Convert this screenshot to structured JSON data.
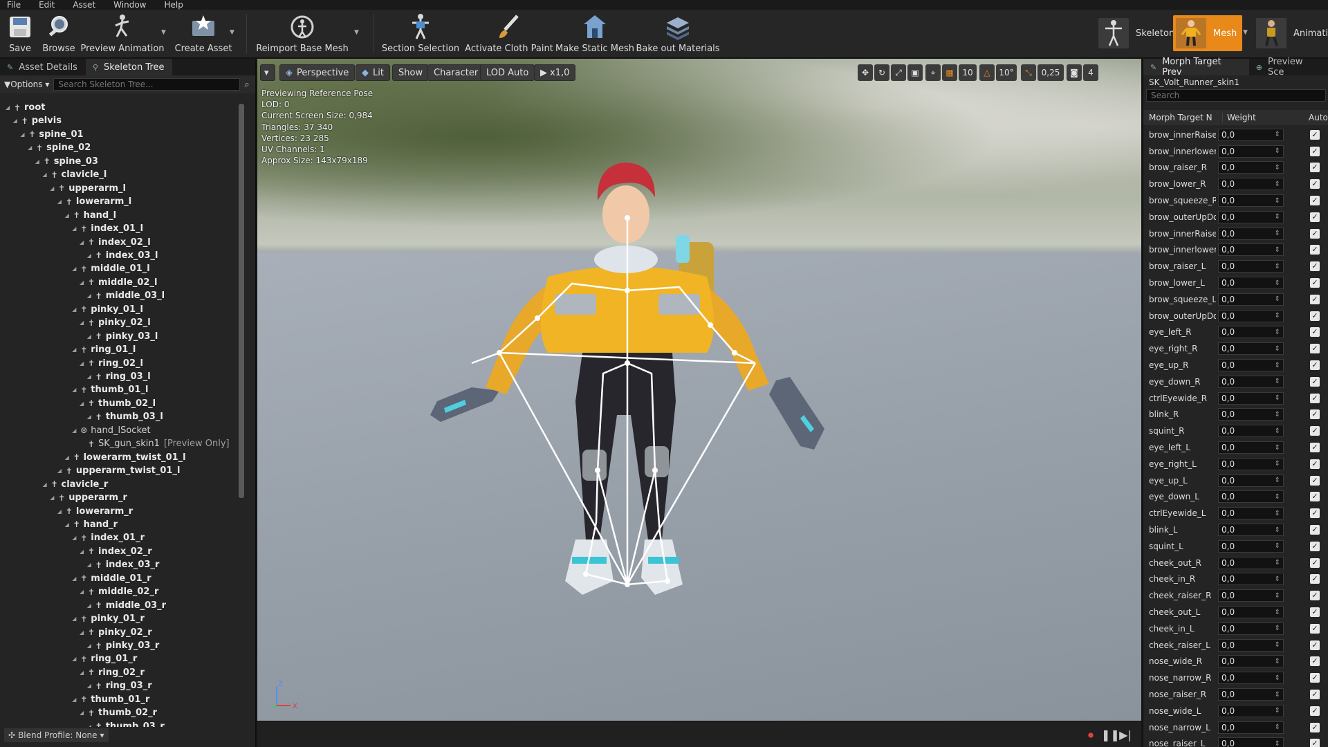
{
  "menu": [
    "File",
    "Edit",
    "Asset",
    "Window",
    "Help"
  ],
  "toolbar": {
    "buttons": [
      {
        "label": "Save"
      },
      {
        "label": "Browse"
      },
      {
        "label": "Preview Animation"
      },
      {
        "label": "Create Asset"
      },
      {
        "label": "Reimport Base Mesh"
      },
      {
        "label": "Section Selection"
      },
      {
        "label": "Activate Cloth Paint"
      },
      {
        "label": "Make Static Mesh"
      },
      {
        "label": "Bake out Materials"
      }
    ],
    "modes": [
      {
        "label": "Skeleton"
      },
      {
        "label": "Mesh"
      },
      {
        "label": "Animatio"
      }
    ],
    "colors": {
      "active_mode": "#e8891a"
    }
  },
  "left_panel": {
    "tabs": [
      {
        "label": "Asset Details"
      },
      {
        "label": "Skeleton Tree"
      }
    ],
    "options_label": "Options",
    "search_placeholder": "Search Skeleton Tree...",
    "tree": [
      {
        "label": "root",
        "depth": 0
      },
      {
        "label": "pelvis",
        "depth": 1
      },
      {
        "label": "spine_01",
        "depth": 2
      },
      {
        "label": "spine_02",
        "depth": 3
      },
      {
        "label": "spine_03",
        "depth": 4
      },
      {
        "label": "clavicle_l",
        "depth": 5
      },
      {
        "label": "upperarm_l",
        "depth": 6
      },
      {
        "label": "lowerarm_l",
        "depth": 7
      },
      {
        "label": "hand_l",
        "depth": 8
      },
      {
        "label": "index_01_l",
        "depth": 9
      },
      {
        "label": "index_02_l",
        "depth": 10
      },
      {
        "label": "index_03_l",
        "depth": 11
      },
      {
        "label": "middle_01_l",
        "depth": 9
      },
      {
        "label": "middle_02_l",
        "depth": 10
      },
      {
        "label": "middle_03_l",
        "depth": 11
      },
      {
        "label": "pinky_01_l",
        "depth": 9
      },
      {
        "label": "pinky_02_l",
        "depth": 10
      },
      {
        "label": "pinky_03_l",
        "depth": 11
      },
      {
        "label": "ring_01_l",
        "depth": 9
      },
      {
        "label": "ring_02_l",
        "depth": 10
      },
      {
        "label": "ring_03_l",
        "depth": 11
      },
      {
        "label": "thumb_01_l",
        "depth": 9
      },
      {
        "label": "thumb_02_l",
        "depth": 10
      },
      {
        "label": "thumb_03_l",
        "depth": 11
      },
      {
        "label": "hand_lSocket",
        "depth": 9,
        "kind": "socket"
      },
      {
        "label": "SK_gun_skin1",
        "depth": 10,
        "kind": "mesh",
        "suffix": "[Preview Only]"
      },
      {
        "label": "lowerarm_twist_01_l",
        "depth": 8
      },
      {
        "label": "upperarm_twist_01_l",
        "depth": 7
      },
      {
        "label": "clavicle_r",
        "depth": 5
      },
      {
        "label": "upperarm_r",
        "depth": 6
      },
      {
        "label": "lowerarm_r",
        "depth": 7
      },
      {
        "label": "hand_r",
        "depth": 8
      },
      {
        "label": "index_01_r",
        "depth": 9
      },
      {
        "label": "index_02_r",
        "depth": 10
      },
      {
        "label": "index_03_r",
        "depth": 11
      },
      {
        "label": "middle_01_r",
        "depth": 9
      },
      {
        "label": "middle_02_r",
        "depth": 10
      },
      {
        "label": "middle_03_r",
        "depth": 11
      },
      {
        "label": "pinky_01_r",
        "depth": 9
      },
      {
        "label": "pinky_02_r",
        "depth": 10
      },
      {
        "label": "pinky_03_r",
        "depth": 11
      },
      {
        "label": "ring_01_r",
        "depth": 9
      },
      {
        "label": "ring_02_r",
        "depth": 10
      },
      {
        "label": "ring_03_r",
        "depth": 11
      },
      {
        "label": "thumb_01_r",
        "depth": 9
      },
      {
        "label": "thumb_02_r",
        "depth": 10
      },
      {
        "label": "thumb_03_r",
        "depth": 11
      }
    ],
    "blend_profile": "Blend Profile: None"
  },
  "viewport": {
    "buttons": [
      "Perspective",
      "Lit",
      "Show",
      "Character",
      "LOD Auto",
      "x1,0"
    ],
    "right_values": {
      "grid_snap": "10",
      "rotation_snap": "10°",
      "scale_snap": "0,25",
      "camera_speed": "4"
    },
    "stats": [
      "Previewing Reference Pose",
      "LOD: 0",
      "Current Screen Size: 0,984",
      "Triangles: 37 340",
      "Vertices: 23 285",
      "UV Channels: 1",
      "Approx Size: 143x79x189"
    ],
    "axis": {
      "z": "Z",
      "x": "X"
    }
  },
  "right_panel": {
    "tabs": [
      {
        "label": "Morph Target Prev"
      },
      {
        "label": "Preview Sce"
      }
    ],
    "asset_name": "SK_Volt_Runner_skin1",
    "search_placeholder": "Search",
    "columns": [
      "Morph Target N",
      "Weight",
      "Auto"
    ],
    "morphs": [
      {
        "name": "brow_innerRaise",
        "weight": "0,0"
      },
      {
        "name": "brow_innerlower",
        "weight": "0,0"
      },
      {
        "name": "brow_raiser_R",
        "weight": "0,0"
      },
      {
        "name": "brow_lower_R",
        "weight": "0,0"
      },
      {
        "name": "brow_squeeze_R",
        "weight": "0,0"
      },
      {
        "name": "brow_outerUpDo",
        "weight": "0,0"
      },
      {
        "name": "brow_innerRaise",
        "weight": "0,0"
      },
      {
        "name": "brow_innerlower",
        "weight": "0,0"
      },
      {
        "name": "brow_raiser_L",
        "weight": "0,0"
      },
      {
        "name": "brow_lower_L",
        "weight": "0,0"
      },
      {
        "name": "brow_squeeze_L",
        "weight": "0,0"
      },
      {
        "name": "brow_outerUpDo",
        "weight": "0,0"
      },
      {
        "name": "eye_left_R",
        "weight": "0,0"
      },
      {
        "name": "eye_right_R",
        "weight": "0,0"
      },
      {
        "name": "eye_up_R",
        "weight": "0,0"
      },
      {
        "name": "eye_down_R",
        "weight": "0,0"
      },
      {
        "name": "ctrlEyewide_R",
        "weight": "0,0"
      },
      {
        "name": "blink_R",
        "weight": "0,0"
      },
      {
        "name": "squint_R",
        "weight": "0,0"
      },
      {
        "name": "eye_left_L",
        "weight": "0,0"
      },
      {
        "name": "eye_right_L",
        "weight": "0,0"
      },
      {
        "name": "eye_up_L",
        "weight": "0,0"
      },
      {
        "name": "eye_down_L",
        "weight": "0,0"
      },
      {
        "name": "ctrlEyewide_L",
        "weight": "0,0"
      },
      {
        "name": "blink_L",
        "weight": "0,0"
      },
      {
        "name": "squint_L",
        "weight": "0,0"
      },
      {
        "name": "cheek_out_R",
        "weight": "0,0"
      },
      {
        "name": "cheek_in_R",
        "weight": "0,0"
      },
      {
        "name": "cheek_raiser_R",
        "weight": "0,0"
      },
      {
        "name": "cheek_out_L",
        "weight": "0,0"
      },
      {
        "name": "cheek_in_L",
        "weight": "0,0"
      },
      {
        "name": "cheek_raiser_L",
        "weight": "0,0"
      },
      {
        "name": "nose_wide_R",
        "weight": "0,0"
      },
      {
        "name": "nose_narrow_R",
        "weight": "0,0"
      },
      {
        "name": "nose_raiser_R",
        "weight": "0,0"
      },
      {
        "name": "nose_wide_L",
        "weight": "0,0"
      },
      {
        "name": "nose_narrow_L",
        "weight": "0,0"
      },
      {
        "name": "nose_raiser_L",
        "weight": "0,0"
      }
    ]
  }
}
